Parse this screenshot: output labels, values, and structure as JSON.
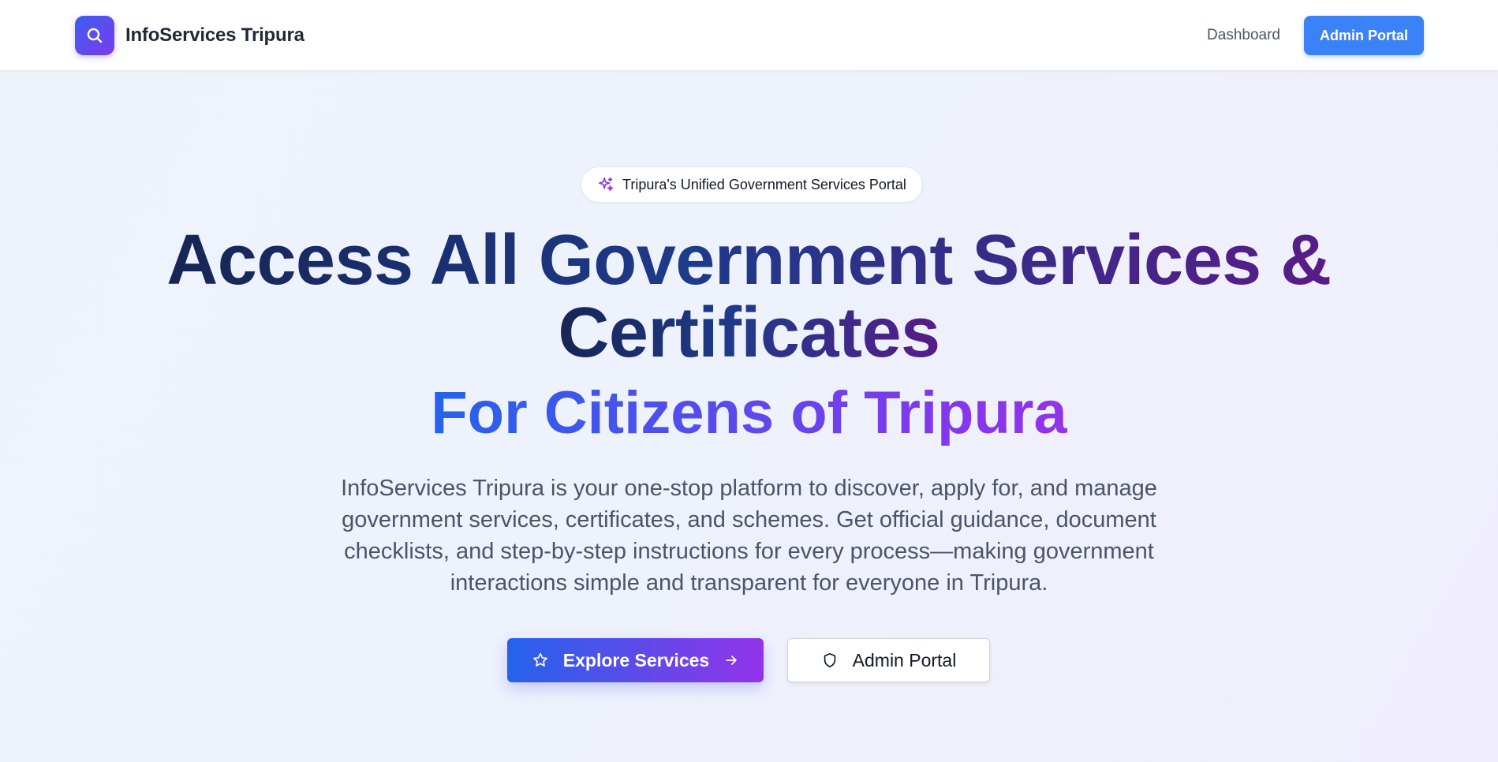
{
  "header": {
    "brand_name": "InfoServices Tripura",
    "logo_icon": "search-icon",
    "nav": {
      "dashboard_label": "Dashboard",
      "admin_portal_label": "Admin Portal"
    }
  },
  "hero": {
    "badge": {
      "icon": "sparkles-icon",
      "text": "Tripura's Unified Government Services Portal"
    },
    "headline_line1": "Access All Government Services &",
    "headline_line2": "Certificates",
    "subheadline": "For Citizens of Tripura",
    "description": "InfoServices Tripura is your one-stop platform to discover, apply for, and manage government services, certificates, and schemes. Get official guidance, document checklists, and step-by-step instructions for every process—making government interactions simple and transparent for everyone in Tripura.",
    "buttons": {
      "explore_label": "Explore Services",
      "explore_icon": "star-icon",
      "explore_trailing_icon": "arrow-right-icon",
      "admin_label": "Admin Portal",
      "admin_icon": "shield-icon"
    }
  },
  "colors": {
    "primary_blue": "#3b82f6",
    "gradient_start": "#2563eb",
    "gradient_end": "#9333ea",
    "headline_dark": "#172554",
    "text_muted": "#4b5563"
  }
}
